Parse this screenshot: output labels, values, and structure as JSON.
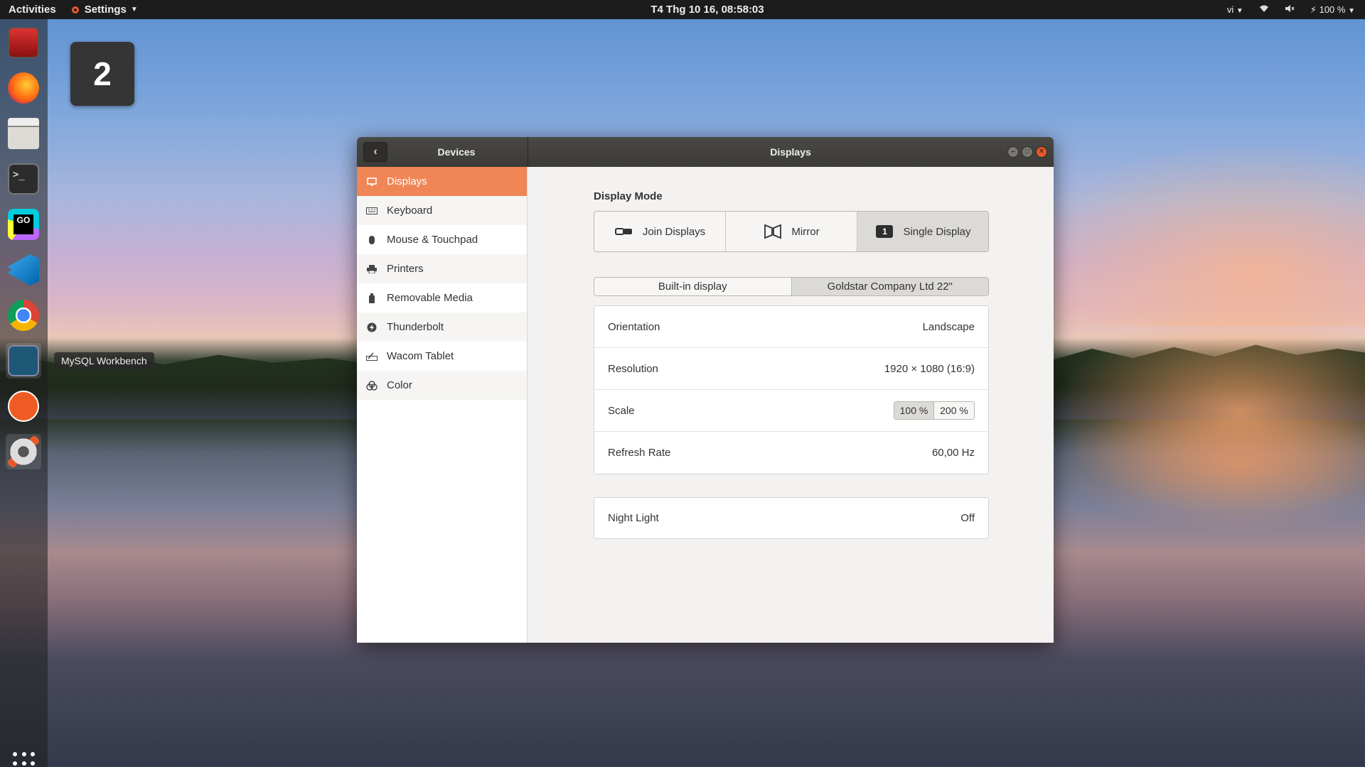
{
  "topbar": {
    "activities": "Activities",
    "app_menu": "Settings",
    "clock": "T4 Thg 10 16, 08:58:03",
    "lang": "vi",
    "battery": "100 %"
  },
  "workspace": {
    "number": "2"
  },
  "dock": {
    "tooltip": "MySQL Workbench",
    "items": [
      {
        "icon": "app-red-icon"
      },
      {
        "icon": "firefox-icon"
      },
      {
        "icon": "files-icon"
      },
      {
        "icon": "terminal-icon"
      },
      {
        "icon": "goland-icon"
      },
      {
        "icon": "vscode-icon"
      },
      {
        "icon": "chrome-icon"
      },
      {
        "icon": "mysql-workbench-icon"
      },
      {
        "icon": "postman-icon"
      },
      {
        "icon": "settings-icon"
      }
    ]
  },
  "window": {
    "sidebar_title": "Devices",
    "main_title": "Displays",
    "sidebar": [
      {
        "label": "Displays",
        "icon": "display-icon",
        "selected": true
      },
      {
        "label": "Keyboard",
        "icon": "keyboard-icon"
      },
      {
        "label": "Mouse & Touchpad",
        "icon": "mouse-icon"
      },
      {
        "label": "Printers",
        "icon": "printer-icon"
      },
      {
        "label": "Removable Media",
        "icon": "removable-media-icon"
      },
      {
        "label": "Thunderbolt",
        "icon": "thunderbolt-icon"
      },
      {
        "label": "Wacom Tablet",
        "icon": "tablet-icon"
      },
      {
        "label": "Color",
        "icon": "color-icon"
      }
    ],
    "display_mode": {
      "title": "Display Mode",
      "options": [
        "Join Displays",
        "Mirror",
        "Single Display"
      ],
      "single_badge": "1",
      "selected": "Single Display"
    },
    "display_tabs": [
      "Built-in display",
      "Goldstar Company Ltd 22\""
    ],
    "settings": {
      "orientation_label": "Orientation",
      "orientation_value": "Landscape",
      "resolution_label": "Resolution",
      "resolution_value": "1920 × 1080 (16:9)",
      "scale_label": "Scale",
      "scale_options": [
        "100 %",
        "200 %"
      ],
      "refresh_label": "Refresh Rate",
      "refresh_value": "60,00 Hz"
    },
    "night_light": {
      "label": "Night Light",
      "value": "Off"
    }
  },
  "colors": {
    "accent": "#f08556",
    "topbar": "#1c1c1c",
    "titlebar": "#3c3b37"
  }
}
